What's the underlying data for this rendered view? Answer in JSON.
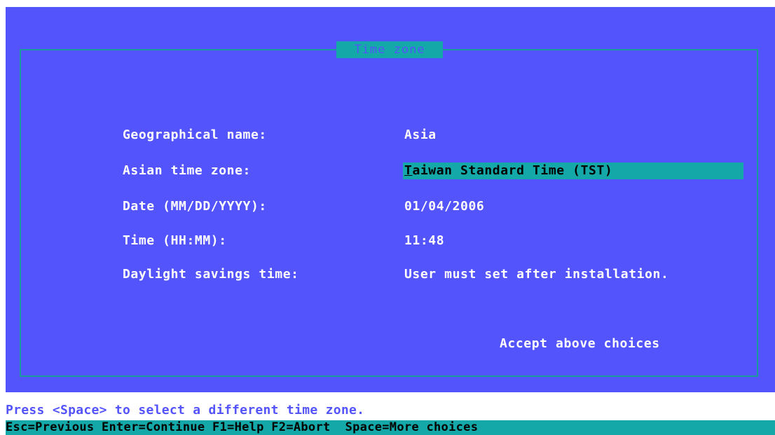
{
  "dialog": {
    "title": "Time zone"
  },
  "fields": [
    {
      "label": "Geographical name:",
      "value": "Asia"
    },
    {
      "label": "Asian time zone:",
      "value_first": "T",
      "value_rest": "aiwan Standard Time (TST)"
    },
    {
      "label": "Date (MM/DD/YYYY):",
      "value": "01/04/2006"
    },
    {
      "label": "Time (HH:MM):",
      "value": "11:48"
    },
    {
      "label": "Daylight savings time:",
      "value": "User must set after installation."
    }
  ],
  "accept_label": "Accept above choices",
  "help_text": "Press <Space> to select a different time zone.",
  "function_keys": "Esc=Previous Enter=Continue F1=Help F2=Abort  Space=More choices",
  "colors": {
    "background": "#5454fc",
    "frame": "#1a9a9a",
    "highlight": "#15a8a8",
    "text": "#ffffff"
  }
}
